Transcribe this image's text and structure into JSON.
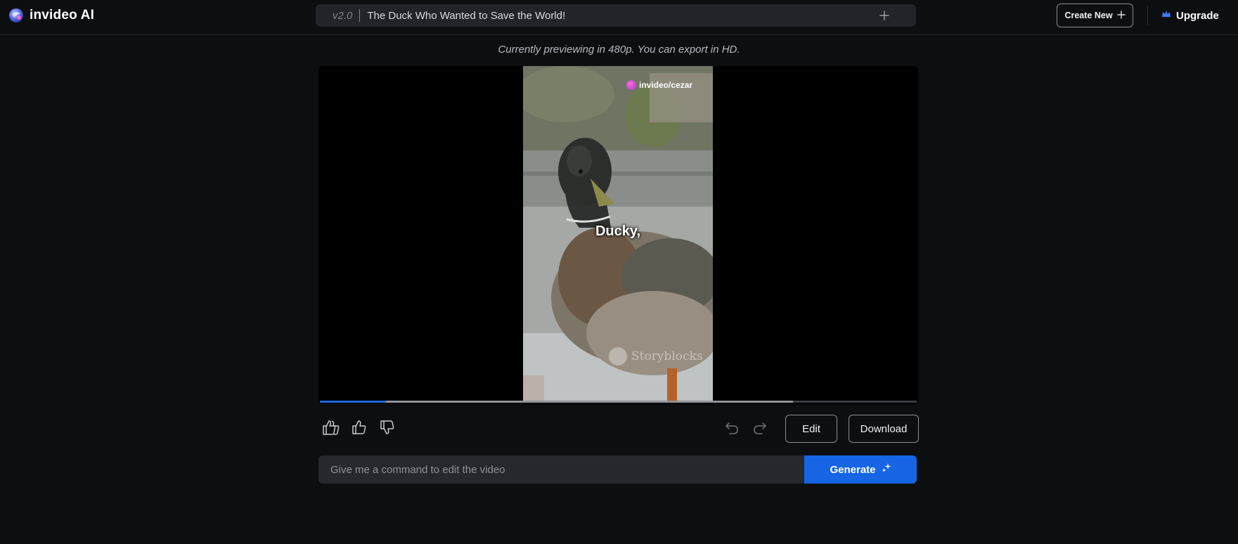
{
  "app": {
    "name": "invideo AI"
  },
  "project": {
    "version": "v2.0",
    "title": "The Duck Who Wanted to Save the World!"
  },
  "header": {
    "create_new_label": "Create New",
    "upgrade_label": "Upgrade"
  },
  "notice": "Currently previewing in 480p. You can export in HD.",
  "video": {
    "watermark_handle": "invideo/cezar",
    "caption": "Ducky,",
    "stock_watermark": "Storyblocks",
    "progress_played": 0.111,
    "progress_buffered": 0.793
  },
  "controls": {
    "edit_label": "Edit",
    "download_label": "Download"
  },
  "command": {
    "placeholder": "Give me a command to edit the video",
    "generate_label": "Generate"
  },
  "colors": {
    "accent": "#1565e4",
    "background": "#0c0e10"
  },
  "icons": {
    "logo": "invideo-logo-icon",
    "plus": "plus-icon",
    "upgrade": "crown-icon",
    "feedback": [
      "double-thumbs-up-icon",
      "thumbs-up-icon",
      "thumbs-down-icon"
    ],
    "history": [
      "undo-icon",
      "redo-icon"
    ],
    "generate": "sparkle-icon"
  }
}
